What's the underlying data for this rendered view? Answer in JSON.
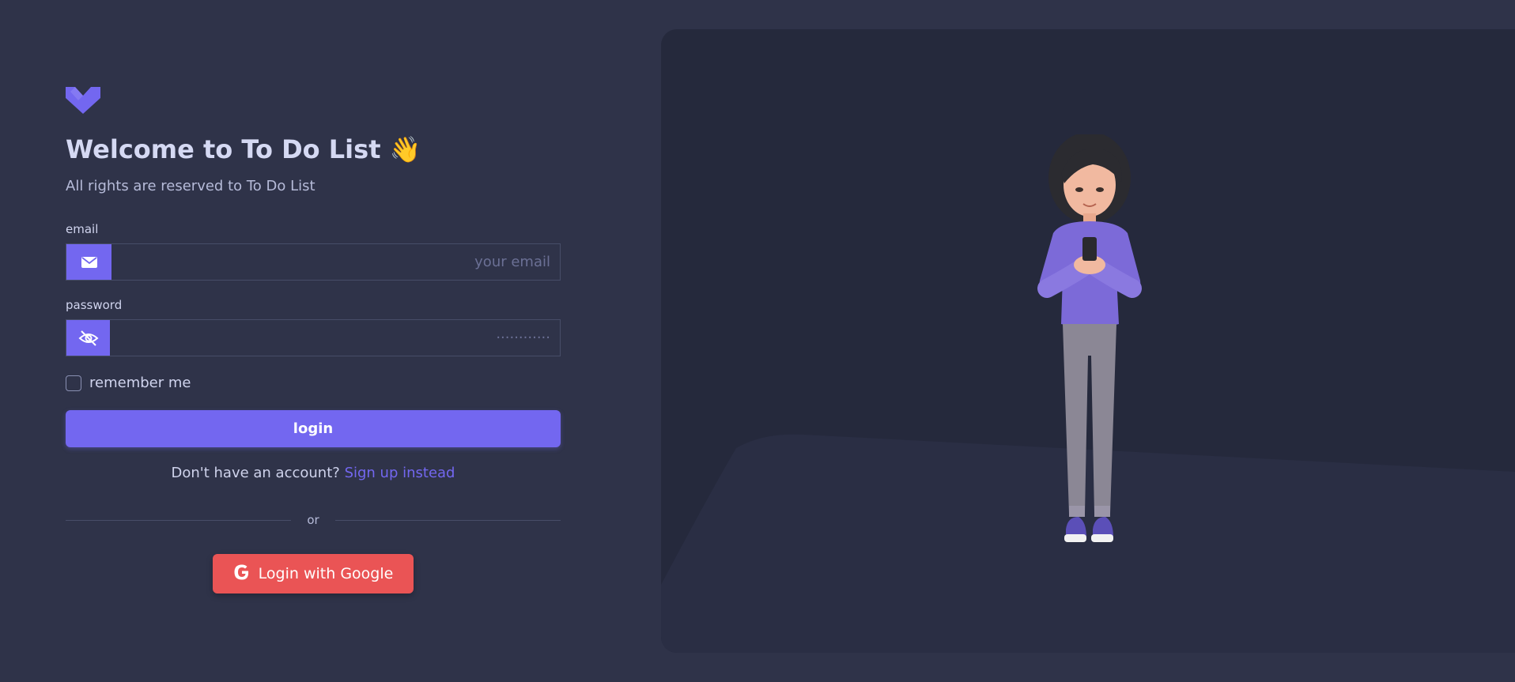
{
  "app": {
    "title": "Welcome to To Do List 👋",
    "subtitle": "All rights are reserved to To Do List",
    "logo": "vuexy-logo"
  },
  "form": {
    "email_label": "email",
    "email_placeholder": "your email",
    "email_icon": "envelope-icon",
    "password_label": "password",
    "password_placeholder": "············",
    "password_icon": "eye-off-icon",
    "remember_label": "remember me",
    "remember_checked": false,
    "login_label": "login"
  },
  "signup": {
    "prompt": "Don't have an account?",
    "link": "Sign up instead"
  },
  "divider": {
    "text": "or"
  },
  "google": {
    "label": "Login with Google",
    "icon": "google-icon"
  },
  "illustration": {
    "icon": "woman-with-phone-illustration"
  },
  "colors": {
    "background": "#2f3349",
    "panel": "#25293c",
    "primary": "#7367f0",
    "danger": "#ea5455",
    "text": "#cfd3ec"
  }
}
